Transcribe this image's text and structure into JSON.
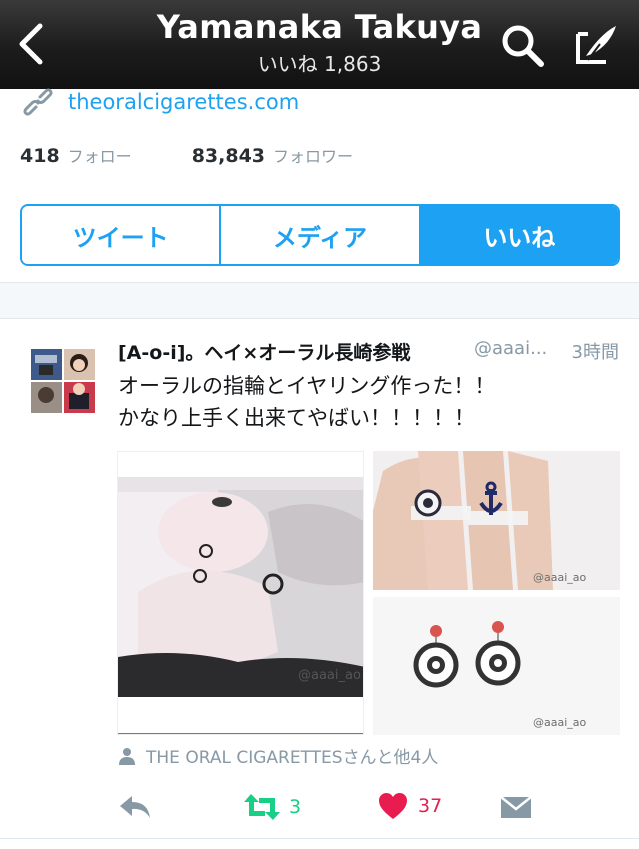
{
  "header": {
    "title": "Yamanaka Takuya",
    "subtitle": "いいね 1,863"
  },
  "profile": {
    "website": "theoralcigarettes.com",
    "following_count": "418",
    "following_label": "フォロー",
    "followers_count": "83,843",
    "followers_label": "フォロワー"
  },
  "tabs": [
    {
      "label": "ツイート",
      "active": false
    },
    {
      "label": "メディア",
      "active": false
    },
    {
      "label": "いいね",
      "active": true
    }
  ],
  "tweet": {
    "name": "[A-o-i]。ヘイ×オーラル長崎参戦",
    "handle": "@aaai...",
    "time": "3時間",
    "text_line1": "オーラルの指輪とイヤリング作った！！",
    "text_line2": "かなり上手く出来てやばい！！！！！",
    "media": [
      {
        "watermark": "@aaai_ao"
      },
      {
        "watermark": "@aaai_ao"
      },
      {
        "watermark": "@aaai_ao"
      }
    ],
    "liked_by": "THE ORAL CIGARETTESさんと他4人",
    "retweet_count": "3",
    "like_count": "37"
  },
  "icons": {
    "back": "chevron-left-icon",
    "search": "search-icon",
    "compose": "compose-icon",
    "link": "link-icon",
    "person": "person-icon",
    "reply": "reply-icon",
    "retweet": "retweet-icon",
    "like": "heart-icon",
    "dm": "envelope-icon"
  },
  "colors": {
    "accent": "#1da1f2",
    "retweet": "#19cf86",
    "like": "#e81c4f",
    "muted": "#8899a6"
  }
}
